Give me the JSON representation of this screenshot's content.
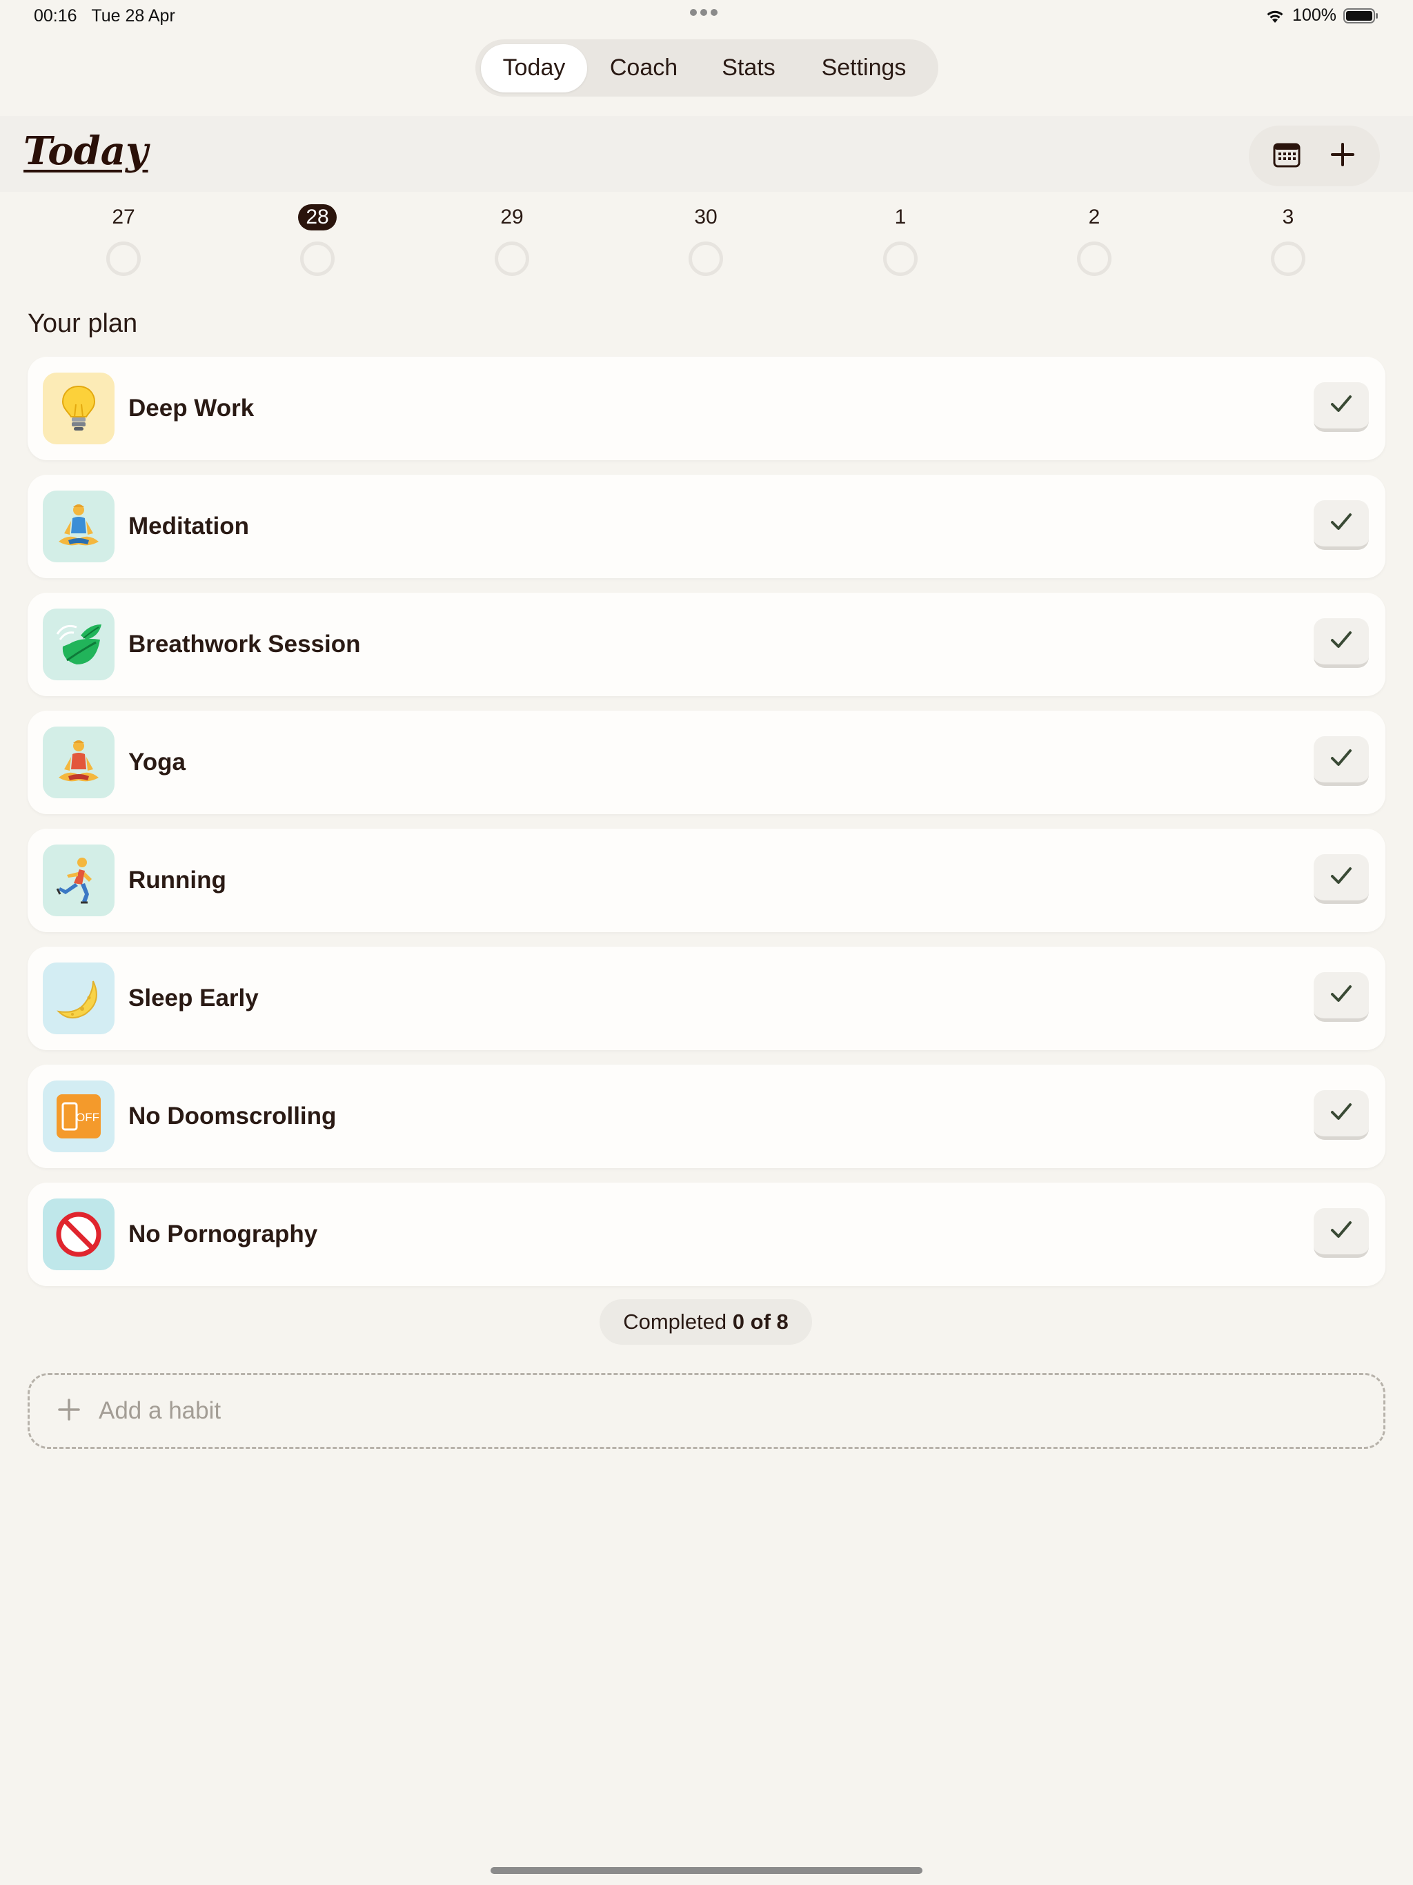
{
  "status_bar": {
    "time": "00:16",
    "date": "Tue 28 Apr",
    "battery": "100%"
  },
  "nav": {
    "tabs": [
      {
        "label": "Today",
        "active": true
      },
      {
        "label": "Coach",
        "active": false
      },
      {
        "label": "Stats",
        "active": false
      },
      {
        "label": "Settings",
        "active": false
      }
    ]
  },
  "header": {
    "title": "Today",
    "actions": [
      "calendar-icon",
      "plus-icon"
    ]
  },
  "week": {
    "days": [
      "27",
      "28",
      "29",
      "30",
      "1",
      "2",
      "3"
    ],
    "selected": "28"
  },
  "plan": {
    "title": "Your plan",
    "habits": [
      {
        "name": "Deep Work",
        "icon": "lightbulb-icon",
        "icon_bg": "#fcebb6"
      },
      {
        "name": "Meditation",
        "icon": "meditation-icon",
        "icon_bg": "#d3eee7"
      },
      {
        "name": "Breathwork Session",
        "icon": "leaf-wind-icon",
        "icon_bg": "#d3eee7"
      },
      {
        "name": "Yoga",
        "icon": "yoga-icon",
        "icon_bg": "#d3eee7"
      },
      {
        "name": "Running",
        "icon": "running-icon",
        "icon_bg": "#d3eee7"
      },
      {
        "name": "Sleep Early",
        "icon": "moon-icon",
        "icon_bg": "#d3edf3"
      },
      {
        "name": "No Doomscrolling",
        "icon": "phone-off-icon",
        "icon_bg": "#d3edf3"
      },
      {
        "name": "No Pornography",
        "icon": "prohibited-icon",
        "icon_bg": "#bfe7ea"
      }
    ]
  },
  "progress": {
    "label": "Completed",
    "count": "0 of 8"
  },
  "add_habit": {
    "label": "Add a habit"
  },
  "colors": {
    "background": "#f6f4ef",
    "accent_dark": "#2a140c",
    "card": "#fefdfb"
  }
}
